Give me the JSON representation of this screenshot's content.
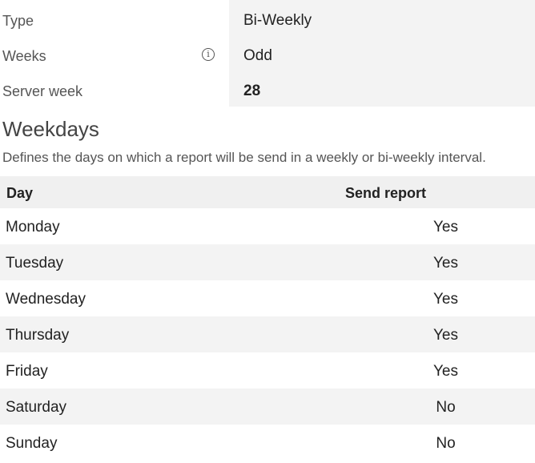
{
  "properties": {
    "type_label": "Type",
    "type_value": "Bi-Weekly",
    "weeks_label": "Weeks",
    "weeks_info_icon": "info-icon",
    "weeks_value": "Odd",
    "server_week_label": "Server week",
    "server_week_value": "28"
  },
  "weekdays": {
    "title": "Weekdays",
    "description": "Defines the days on which a report will be send in a weekly or bi-weekly interval.",
    "columns": [
      "Day",
      "Send report"
    ],
    "rows": [
      {
        "day": "Monday",
        "send": "Yes"
      },
      {
        "day": "Tuesday",
        "send": "Yes"
      },
      {
        "day": "Wednesday",
        "send": "Yes"
      },
      {
        "day": "Thursday",
        "send": "Yes"
      },
      {
        "day": "Friday",
        "send": "Yes"
      },
      {
        "day": "Saturday",
        "send": "No"
      },
      {
        "day": "Sunday",
        "send": "No"
      }
    ]
  }
}
